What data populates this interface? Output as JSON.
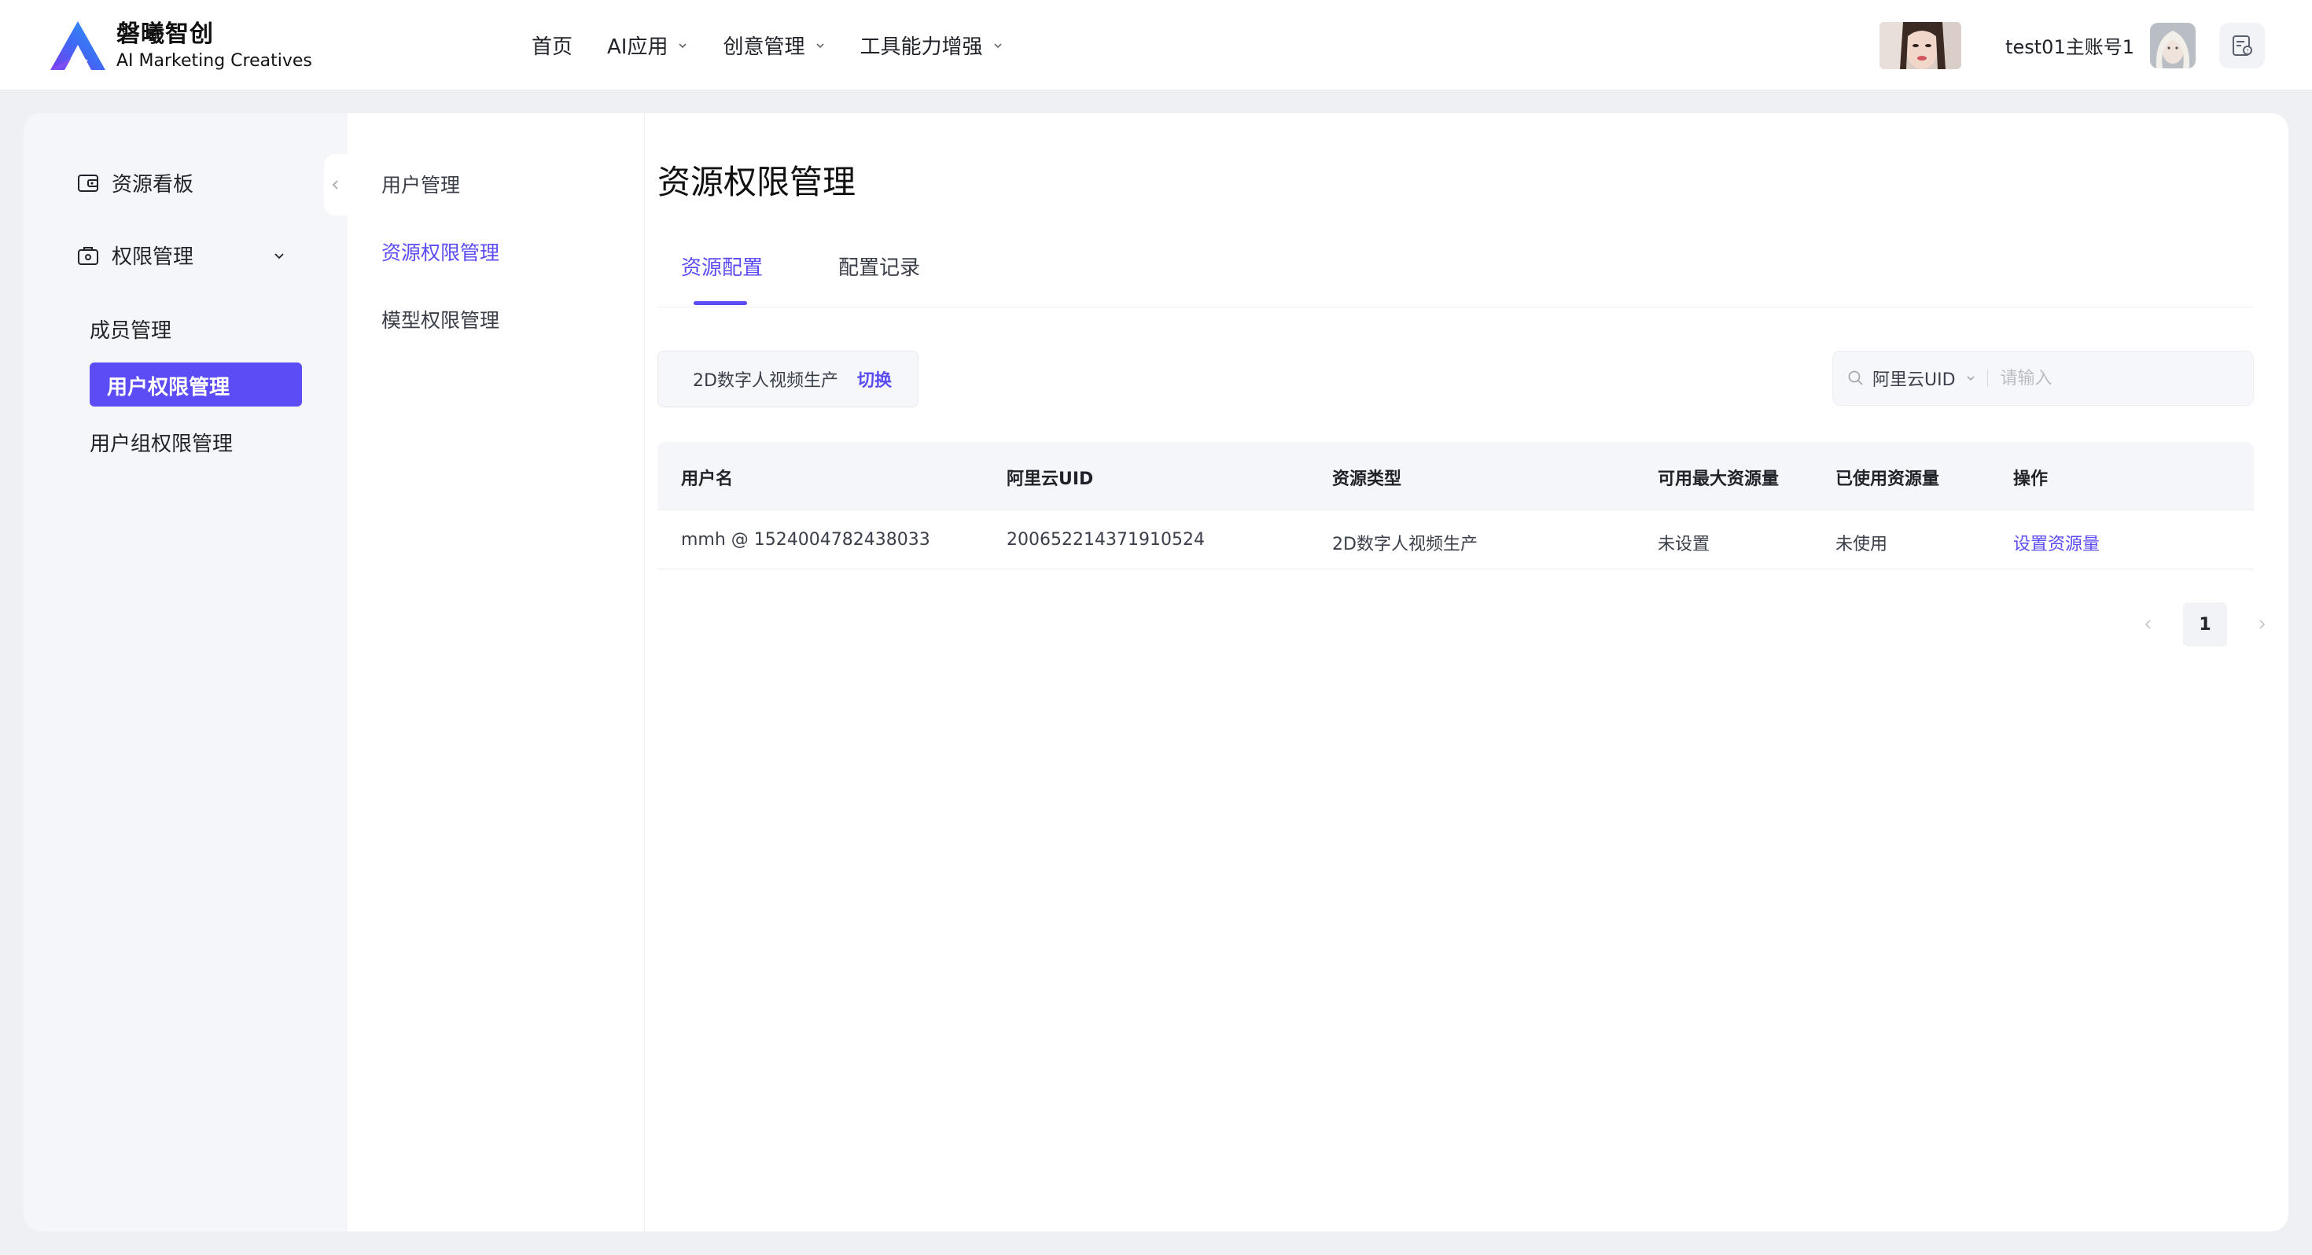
{
  "brand": {
    "name": "磐曦智创",
    "subtitle": "AI Marketing Creatives"
  },
  "nav": [
    {
      "label": "首页",
      "dropdown": false
    },
    {
      "label": "AI应用",
      "dropdown": true
    },
    {
      "label": "创意管理",
      "dropdown": true
    },
    {
      "label": "工具能力增强",
      "dropdown": true
    }
  ],
  "header": {
    "username": "test01主账号1"
  },
  "sidebar": {
    "dashboard": "资源看板",
    "permissions": "权限管理",
    "sub_items": [
      "成员管理",
      "用户权限管理",
      "用户组权限管理"
    ],
    "active_index": 1
  },
  "subnav": {
    "items": [
      "用户管理",
      "资源权限管理",
      "模型权限管理"
    ],
    "active_index": 1
  },
  "page": {
    "title": "资源权限管理",
    "tabs": [
      "资源配置",
      "配置记录"
    ],
    "active_tab": 0,
    "resource_switch": {
      "label": "2D数字人视频生产",
      "action": "切换"
    },
    "search": {
      "field": "阿里云UID",
      "placeholder": "请输入",
      "value": ""
    }
  },
  "table": {
    "headers": [
      "用户名",
      "阿里云UID",
      "资源类型",
      "可用最大资源量",
      "已使用资源量",
      "操作"
    ],
    "rows": [
      [
        "mmh @ 1524004782438033",
        "200652214371910524",
        "2D数字人视频生产",
        "未设置",
        "未使用",
        "设置资源量"
      ]
    ]
  },
  "pagination": {
    "current": "1"
  },
  "colors": {
    "accent": "#5b4cf5",
    "page_bg": "#eef0f4",
    "sidebar_bg": "#f5f6f9"
  }
}
